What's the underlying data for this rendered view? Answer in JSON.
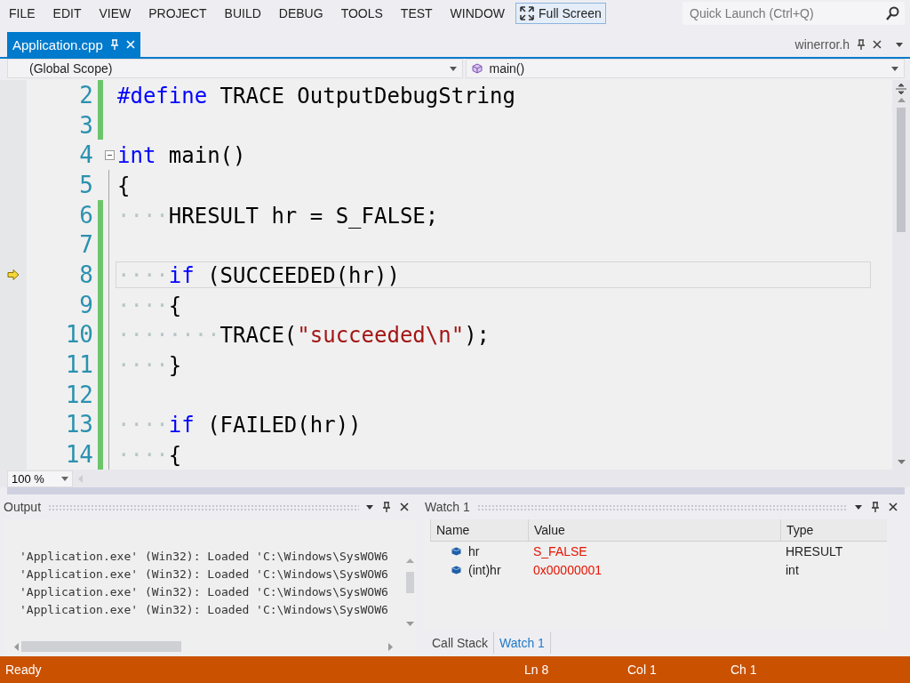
{
  "menu": [
    {
      "label": "FILE"
    },
    {
      "label": "EDIT"
    },
    {
      "label": "VIEW"
    },
    {
      "label": "PROJECT"
    },
    {
      "label": "BUILD"
    },
    {
      "label": "DEBUG"
    },
    {
      "label": "TOOLS"
    },
    {
      "label": "TEST"
    },
    {
      "label": "WINDOW"
    }
  ],
  "full_screen": {
    "label": "Full Screen"
  },
  "quick_launch": {
    "placeholder": "Quick Launch (Ctrl+Q)"
  },
  "doc_tabs": [
    {
      "label": "Application.cpp",
      "selected": true
    },
    {
      "label": "winerror.h",
      "selected": false
    }
  ],
  "scope": {
    "left": "(Global Scope)",
    "right": "main()"
  },
  "editor": {
    "lines": [
      {
        "number": "2",
        "changed": true,
        "current": false,
        "tokens": [
          {
            "kind": "keyword",
            "text": "#define"
          },
          {
            "kind": "plain",
            "text": " TRACE OutputDebugString"
          }
        ]
      },
      {
        "number": "3",
        "changed": true,
        "current": false
      },
      {
        "number": "4",
        "changed": false,
        "current": false,
        "expanded": true,
        "tokens": [
          {
            "kind": "keyword",
            "text": "int"
          },
          {
            "kind": "plain",
            "text": " main()"
          }
        ]
      },
      {
        "number": "5",
        "changed": false,
        "current": false,
        "tokens": [
          {
            "kind": "plain",
            "text": "{"
          }
        ]
      },
      {
        "number": "6",
        "changed": true,
        "current": false,
        "tokens": [
          {
            "kind": "space",
            "text": "····"
          },
          {
            "kind": "plain",
            "text": "HRESULT hr = S_FALSE;"
          }
        ]
      },
      {
        "number": "7",
        "changed": true,
        "current": false
      },
      {
        "number": "8",
        "changed": true,
        "current": true,
        "tokens": [
          {
            "kind": "space",
            "text": "····"
          },
          {
            "kind": "keyword",
            "text": "if"
          },
          {
            "kind": "plain",
            "text": " (SUCCEEDED(hr))"
          }
        ]
      },
      {
        "number": "9",
        "changed": true,
        "current": false,
        "tokens": [
          {
            "kind": "space",
            "text": "····"
          },
          {
            "kind": "plain",
            "text": "{"
          }
        ]
      },
      {
        "number": "10",
        "changed": true,
        "current": false,
        "tokens": [
          {
            "kind": "space",
            "text": "········"
          },
          {
            "kind": "plain",
            "text": "TRACE("
          },
          {
            "kind": "string",
            "text": "\"succeeded\\n\""
          },
          {
            "kind": "plain",
            "text": ");"
          }
        ]
      },
      {
        "number": "11",
        "changed": true,
        "current": false,
        "tokens": [
          {
            "kind": "space",
            "text": "····"
          },
          {
            "kind": "plain",
            "text": "}"
          }
        ]
      },
      {
        "number": "12",
        "changed": true,
        "current": false
      },
      {
        "number": "13",
        "changed": true,
        "current": false,
        "tokens": [
          {
            "kind": "space",
            "text": "····"
          },
          {
            "kind": "keyword",
            "text": "if"
          },
          {
            "kind": "plain",
            "text": " (FAILED(hr))"
          }
        ]
      },
      {
        "number": "14",
        "changed": true,
        "current": false,
        "tokens": [
          {
            "kind": "space",
            "text": "····"
          },
          {
            "kind": "plain",
            "text": "{"
          }
        ]
      }
    ]
  },
  "zoom": "100 %",
  "output": {
    "title": "Output",
    "lines": [
      "'Application.exe' (Win32): Loaded 'C:\\Windows\\SysWOW6",
      "'Application.exe' (Win32): Loaded 'C:\\Windows\\SysWOW6",
      "'Application.exe' (Win32): Loaded 'C:\\Windows\\SysWOW6",
      "'Application.exe' (Win32): Loaded 'C:\\Windows\\SysWOW6"
    ]
  },
  "watch": {
    "title": "Watch 1",
    "columns": [
      "Name",
      "Value",
      "Type"
    ],
    "rows": [
      {
        "name": "hr",
        "value": "S_FALSE",
        "type": "HRESULT",
        "changed": true
      },
      {
        "name": "(int)hr",
        "value": "0x00000001",
        "type": "int",
        "changed": true
      }
    ]
  },
  "bottom_tabs": [
    {
      "label": "Call Stack",
      "selected": false
    },
    {
      "label": "Watch 1",
      "selected": true
    }
  ],
  "status": {
    "text": "Ready",
    "ln": "Ln 8",
    "col": "Col 1",
    "ch": "Ch 1"
  }
}
